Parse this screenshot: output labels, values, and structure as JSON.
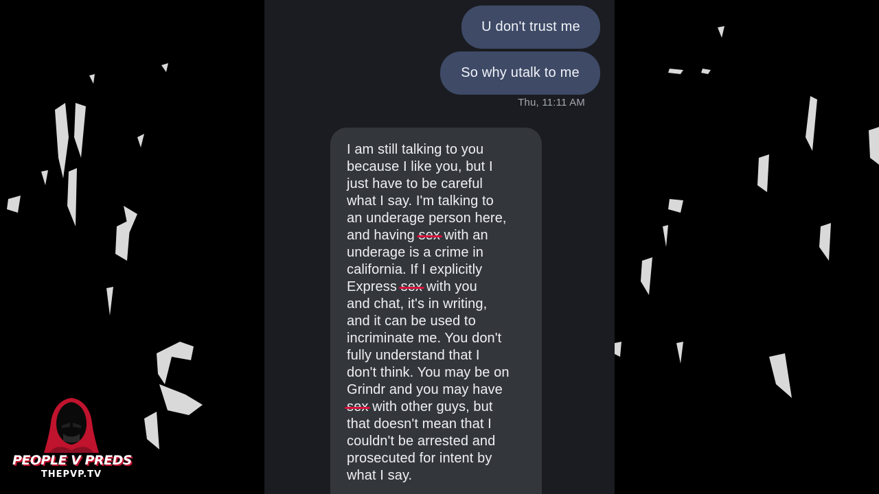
{
  "conversation": {
    "outgoing": [
      {
        "text": "U don't trust me"
      },
      {
        "text": "So why utalk to me"
      }
    ],
    "timestamp": "Thu, 11:11 AM",
    "incoming": {
      "lines": [
        [
          "I am still talking to you"
        ],
        [
          "because I like you, but I"
        ],
        [
          "just have to be careful"
        ],
        [
          "what I say. I'm talking to"
        ],
        [
          "an underage person here,"
        ],
        [
          "and having ",
          "sex",
          " with an"
        ],
        [
          "underage is a crime in"
        ],
        [
          "california. If I explicitly"
        ],
        [
          "Express ",
          "sex",
          " with you"
        ],
        [
          "and chat, it's in writing,"
        ],
        [
          "and it can be used to"
        ],
        [
          "incriminate me. You don't"
        ],
        [
          "fully understand that I"
        ],
        [
          "don't think. You may be on"
        ],
        [
          "Grindr and you may have"
        ],
        [
          "",
          "sex",
          " with other guys, but"
        ],
        [
          "that doesn't mean that I"
        ],
        [
          "couldn't be arrested and"
        ],
        [
          "prosecuted for intent by"
        ],
        [
          "what I say."
        ]
      ]
    }
  },
  "watermark": {
    "title": "PEOPLE V PREDS",
    "subtitle": "THEPVP.TV",
    "icon": "hooded-figure-icon"
  },
  "colors": {
    "phone_background": "#1a1c21",
    "outgoing_bubble": "#3e4a66",
    "incoming_bubble": "#33363b",
    "redaction_line": "#d8133b",
    "logo_red": "#c0132d"
  }
}
